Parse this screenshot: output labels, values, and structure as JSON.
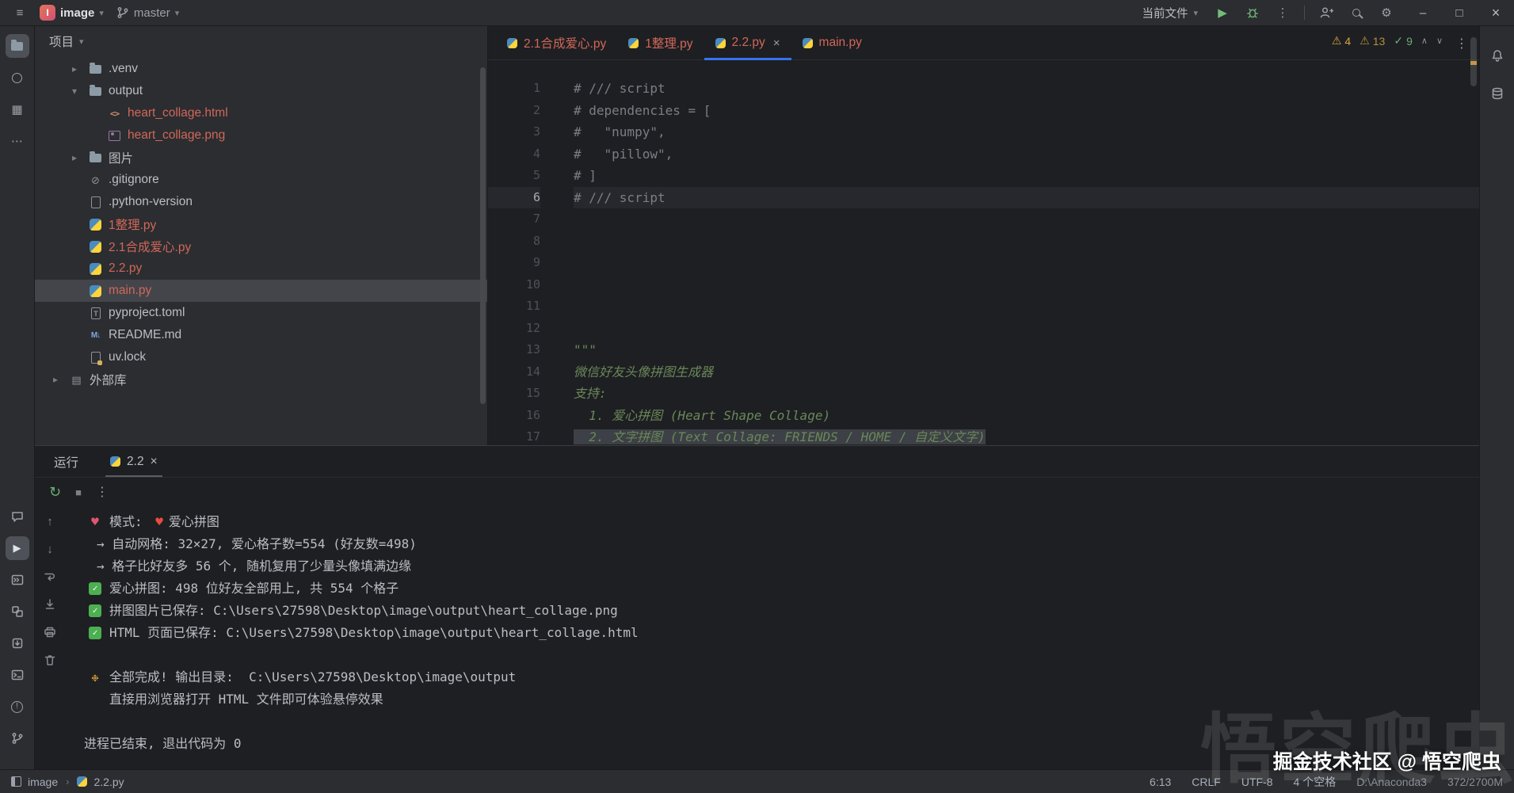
{
  "colors": {
    "accent": "#3574f0",
    "unversioned_file": "#d1675a",
    "success_green": "#4caf50",
    "warning_yellow": "#d9a343",
    "run_green": "#6aab73",
    "panel_bg": "#2b2d30",
    "editor_bg": "#1e1f22"
  },
  "icons": {
    "hamburger": "≡",
    "chevron_down": "▾",
    "chevron_right": "▸",
    "breadcrumb_sep": "›",
    "more_vertical": "⋮",
    "more_horizontal": "⋯",
    "gear": "⚙",
    "play": "▶",
    "rerun": "↻",
    "stop": "■",
    "warning": "⚠",
    "check_mark": "✓",
    "close": "×",
    "minimize": "–",
    "maximize": "□",
    "up_arrow": "↑",
    "down_arrow": "↓",
    "collapse_up": "∧",
    "expand_down": "∨",
    "html_tag": "<>",
    "markdown": "M↓",
    "ignore": "⊘",
    "library": "▤",
    "structure": "▦",
    "heart": "♥",
    "party": "❉",
    "bang": "!",
    "toml_badge": "T",
    "project_initial": "I"
  },
  "titlebar": {
    "project": "image",
    "branch": "master",
    "run_config": "当前文件"
  },
  "project_panel": {
    "title": "项目",
    "tree": [
      {
        "label": ".venv"
      },
      {
        "label": "output"
      },
      {
        "label": "heart_collage.html"
      },
      {
        "label": "heart_collage.png"
      },
      {
        "label": "图片"
      },
      {
        "label": ".gitignore"
      },
      {
        "label": ".python-version"
      },
      {
        "label": "1整理.py"
      },
      {
        "label": "2.1合成爱心.py"
      },
      {
        "label": "2.2.py"
      },
      {
        "label": "main.py"
      },
      {
        "label": "pyproject.toml"
      },
      {
        "label": "README.md"
      },
      {
        "label": "uv.lock"
      },
      {
        "label": "外部库"
      }
    ]
  },
  "tabs": [
    {
      "label": "2.1合成爱心.py"
    },
    {
      "label": "1整理.py"
    },
    {
      "label": "2.2.py"
    },
    {
      "label": "main.py"
    }
  ],
  "editor": {
    "inspections": {
      "weak_warnings": "4",
      "warnings": "13",
      "passed": "9"
    },
    "lines": [
      {
        "n": "1",
        "text": "# /// script"
      },
      {
        "n": "2",
        "text": "# dependencies = ["
      },
      {
        "n": "3",
        "text": "#   \"numpy\","
      },
      {
        "n": "4",
        "text": "#   \"pillow\","
      },
      {
        "n": "5",
        "text": "# ]"
      },
      {
        "n": "6",
        "text": "# /// script"
      },
      {
        "n": "7",
        "text": ""
      },
      {
        "n": "8",
        "text": ""
      },
      {
        "n": "9",
        "text": ""
      },
      {
        "n": "10",
        "text": ""
      },
      {
        "n": "11",
        "text": ""
      },
      {
        "n": "12",
        "text": ""
      },
      {
        "n": "13",
        "text": "\"\"\""
      },
      {
        "n": "14",
        "text": "微信好友头像拼图生成器"
      },
      {
        "n": "15",
        "text": "支持:"
      },
      {
        "n": "16",
        "text": "  1. 爱心拼图 (Heart Shape Collage)"
      },
      {
        "n": "17",
        "text": "  2. 文字拼图 (Text Collage: FRIENDS / HOME / 自定义文字)"
      }
    ]
  },
  "run": {
    "panel_title": "运行",
    "tab": "2.2",
    "console": [
      {
        "pre": "模式: ",
        "post": "爱心拼图"
      },
      {
        "text": "→ 自动网格: 32×27, 爱心格子数=554 (好友数=498)"
      },
      {
        "text": "→ 格子比好友多 56 个, 随机复用了少量头像填满边缘"
      },
      {
        "text": "爱心拼图: 498 位好友全部用上, 共 554 个格子"
      },
      {
        "text": "拼图图片已保存: C:\\Users\\27598\\Desktop\\image\\output\\heart_collage.png"
      },
      {
        "text": "HTML 页面已保存: C:\\Users\\27598\\Desktop\\image\\output\\heart_collage.html"
      },
      {
        "text": ""
      },
      {
        "text": "全部完成! 输出目录:  C:\\Users\\27598\\Desktop\\image\\output"
      },
      {
        "text": "直接用浏览器打开 HTML 文件即可体验悬停效果"
      },
      {
        "text": ""
      },
      {
        "text": "进程已结束, 退出代码为 0"
      }
    ]
  },
  "statusbar": {
    "root": "image",
    "file": "2.2.py",
    "caret": "6:13",
    "line_separator": "CRLF",
    "encoding": "UTF-8",
    "indent": "4 个空格",
    "interpreter": "D:\\Anaconda3",
    "memory": "372/2700M"
  },
  "watermark": {
    "line": "掘金技术社区 @ 悟空爬虫",
    "ghost": "悟空爬虫"
  }
}
